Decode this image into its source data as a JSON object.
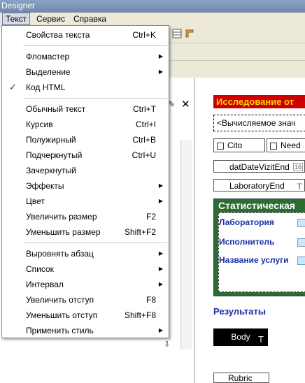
{
  "window": {
    "title": "Designer"
  },
  "menubar": [
    {
      "label": "Текст",
      "active": true
    },
    {
      "label": "Сервис",
      "active": false
    },
    {
      "label": "Справка",
      "active": false
    }
  ],
  "menu": {
    "groups": [
      [
        {
          "label": "Свойства текста",
          "shortcut": "Ctrl+K",
          "submenu": false,
          "checked": false
        }
      ],
      [
        {
          "label": "Фломастер",
          "shortcut": "",
          "submenu": true,
          "checked": false
        },
        {
          "label": "Выделение",
          "shortcut": "",
          "submenu": true,
          "checked": false
        },
        {
          "label": "Код HTML",
          "shortcut": "",
          "submenu": false,
          "checked": true
        }
      ],
      [
        {
          "label": "Обычный текст",
          "shortcut": "Ctrl+T",
          "submenu": false,
          "checked": false
        },
        {
          "label": "Курсив",
          "shortcut": "Ctrl+I",
          "submenu": false,
          "checked": false
        },
        {
          "label": "Полужирный",
          "shortcut": "Ctrl+B",
          "submenu": false,
          "checked": false
        },
        {
          "label": "Подчеркнутый",
          "shortcut": "Ctrl+U",
          "submenu": false,
          "checked": false
        },
        {
          "label": "Зачеркнутый",
          "shortcut": "",
          "submenu": false,
          "checked": false
        },
        {
          "label": "Эффекты",
          "shortcut": "",
          "submenu": true,
          "checked": false
        },
        {
          "label": "Цвет",
          "shortcut": "",
          "submenu": true,
          "checked": false
        },
        {
          "label": "Увеличить размер",
          "shortcut": "F2",
          "submenu": false,
          "checked": false
        },
        {
          "label": "Уменьшить размер",
          "shortcut": "Shift+F2",
          "submenu": false,
          "checked": false
        }
      ],
      [
        {
          "label": "Выровнять абзац",
          "shortcut": "",
          "submenu": true,
          "checked": false
        },
        {
          "label": "Список",
          "shortcut": "",
          "submenu": true,
          "checked": false
        },
        {
          "label": "Интервал",
          "shortcut": "",
          "submenu": true,
          "checked": false
        },
        {
          "label": "Увеличить отступ",
          "shortcut": "F8",
          "submenu": false,
          "checked": false
        },
        {
          "label": "Уменьшить отступ",
          "shortcut": "Shift+F8",
          "submenu": false,
          "checked": false
        },
        {
          "label": "Применить стиль",
          "shortcut": "",
          "submenu": true,
          "checked": false
        }
      ]
    ]
  },
  "designer": {
    "header_band": "Исследование от",
    "expression_field": "<Вычисляемое знач",
    "cito_label": "Cito",
    "need_label": "Need",
    "date_field": "datDateVizitEnd",
    "date_tag": "16",
    "lab_field": "LaboratoryEnd",
    "stat_title": "Статистическая",
    "stat_labels": [
      "Лаборатория",
      "Исполнитель",
      "Название услуги"
    ],
    "results_label": "Результаты",
    "body_button": "Body",
    "bottom_field": "Rubric"
  },
  "icons": {
    "check": "check-mark-icon",
    "submenu": "submenu-arrow-icon",
    "close": "close-icon",
    "pin": "pin-icon",
    "text_type": "text-type-icon"
  },
  "colors": {
    "header_band_bg": "#cc0000",
    "header_band_text": "#ffd400",
    "stat_panel_bg": "#2f6b35",
    "stat_label": "#1a2fa4",
    "results": "#1a2fa4"
  }
}
